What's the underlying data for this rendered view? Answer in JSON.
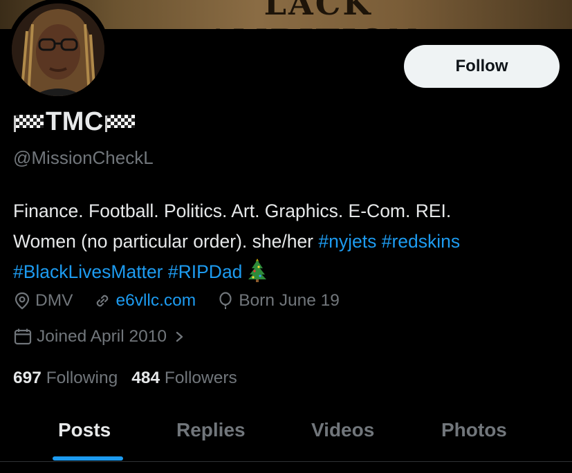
{
  "banner": {
    "text": "LACK AMBITION."
  },
  "profile": {
    "display_name": "TMC",
    "handle": "@MissionCheckL",
    "follow_label": "Follow",
    "bio": {
      "line1": "Finance. Football. Politics. Art. Graphics. E-Com. REI.",
      "line2_text": "Women (no particular order). she/her ",
      "tag_nyjets": "#nyjets",
      "tag_redskins": "#redskins",
      "tag_blm": "#BlackLivesMatter",
      "tag_ripdad": "#RIPDad",
      "emoji": "christmas-tree"
    },
    "location": "DMV",
    "website": "e6vllc.com",
    "birthday": "Born June 19",
    "joined": "Joined April 2010"
  },
  "stats": {
    "following_count": "697",
    "following_label": "Following",
    "followers_count": "484",
    "followers_label": "Followers"
  },
  "tabs": [
    "Posts",
    "Replies",
    "Videos",
    "Photos"
  ],
  "colors": {
    "accent": "#1d9bf0",
    "muted": "#71767b",
    "text": "#e7e9ea",
    "background": "#000000"
  },
  "icons": [
    "checkered-flag-icon",
    "location-pin-icon",
    "link-icon",
    "balloon-icon",
    "calendar-icon",
    "chevron-right-icon",
    "christmas-tree-icon"
  ]
}
